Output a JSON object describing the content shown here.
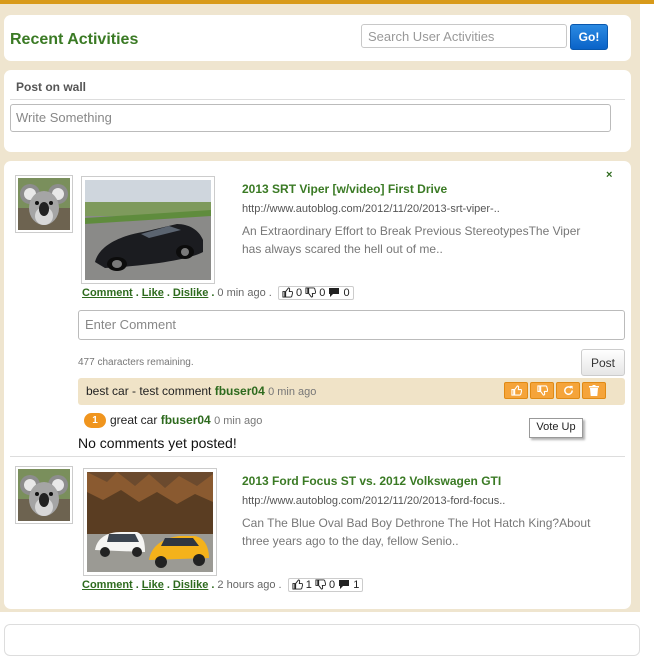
{
  "header": {
    "title": "Recent Activities",
    "search_placeholder": "Search User Activities",
    "search_button": "Go!"
  },
  "wall": {
    "label": "Post on wall",
    "placeholder": "Write Something"
  },
  "feed": {
    "close_label": "×",
    "posts": [
      {
        "title": "2013 SRT Viper [w/video] First Drive",
        "url": "http://www.autoblog.com/2012/11/20/2013-srt-viper-..",
        "description": "An Extraordinary Effort to Break Previous StereotypesThe Viper has always scared the hell out of me..",
        "actions": {
          "comment": "Comment",
          "like": "Like",
          "dislike": "Dislike",
          "sep": ".",
          "time": "0 min ago ."
        },
        "counts": {
          "likes": "0",
          "dislikes": "0",
          "comments": "0"
        },
        "comment_placeholder": "Enter Comment",
        "chars_remaining": "477 characters remaining.",
        "post_button": "Post",
        "comments": [
          {
            "text": "best car - test comment",
            "user": "fbuser04",
            "time": "0 min ago"
          }
        ],
        "reply": {
          "count": "1",
          "text": "great car",
          "user": "fbuser04",
          "time": "0 min ago"
        },
        "tooltip": "Vote Up",
        "no_comments": "No comments yet posted!"
      },
      {
        "title": "2013 Ford Focus ST vs. 2012 Volkswagen GTI",
        "url": "http://www.autoblog.com/2012/11/20/2013-ford-focus..",
        "description": "Can The Blue Oval Bad Boy Dethrone The Hot Hatch King?About three years ago to the day, fellow Senio..",
        "actions": {
          "comment": "Comment",
          "like": "Like",
          "dislike": "Dislike",
          "sep": ".",
          "time": "2 hours ago ."
        },
        "counts": {
          "likes": "1",
          "dislikes": "0",
          "comments": "1"
        }
      }
    ]
  },
  "icons": {
    "thumbs_up": "thumbs-up-icon",
    "thumbs_down": "thumbs-down-icon",
    "comment": "comment-bubble-icon",
    "refresh": "refresh-icon",
    "trash": "trash-icon"
  },
  "colors": {
    "accent_green": "#3a7a24",
    "link_green": "#2d6a1d",
    "go_button": "#1a74d6",
    "frame_beige": "#efe5cf",
    "orange": "#f5a43a",
    "top_bar": "#d89a1a"
  }
}
